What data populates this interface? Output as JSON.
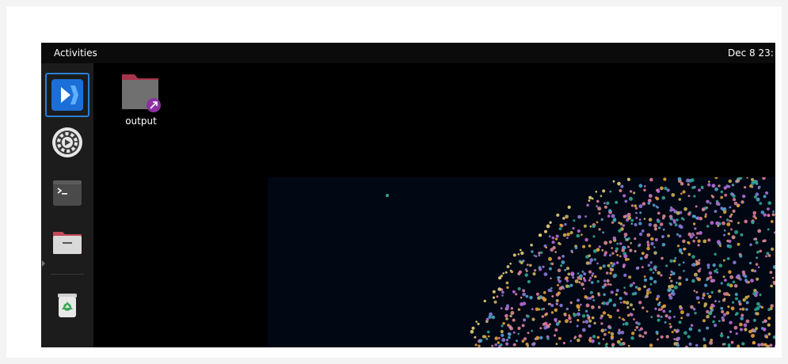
{
  "topbar": {
    "activities_label": "Activities",
    "clock_text": "Dec 8  23:"
  },
  "dock": {
    "items": [
      {
        "name": "app-launcher",
        "icon": "vscode-style-app-icon",
        "active": true
      },
      {
        "name": "settings",
        "icon": "settings-gear-icon",
        "active": false
      },
      {
        "name": "terminal",
        "icon": "terminal-icon",
        "active": false
      },
      {
        "name": "files",
        "icon": "folder-icon",
        "active": false
      },
      {
        "name": "trash",
        "icon": "trash-icon",
        "active": false
      }
    ]
  },
  "desktop": {
    "icons": [
      {
        "label": "output",
        "icon": "folder-link-icon"
      }
    ]
  },
  "colors": {
    "accent": "#2a7fd5",
    "desktop_bg": "#000000",
    "plot_bg": "#020714"
  }
}
